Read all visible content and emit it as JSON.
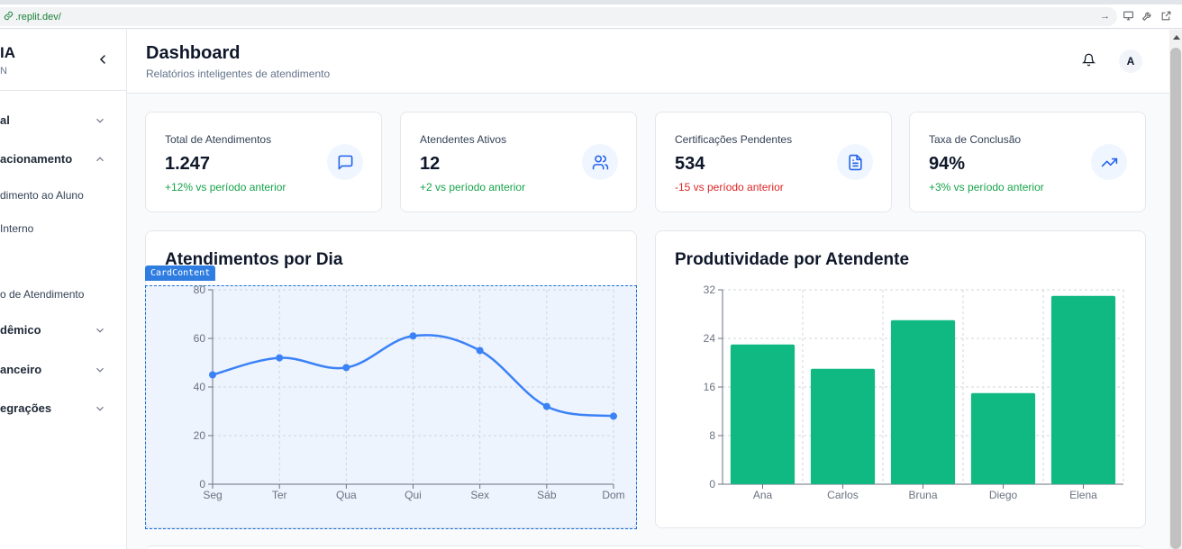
{
  "browser": {
    "url": ".replit.dev/",
    "icons": [
      "link-icon",
      "arrow-right-icon",
      "monitor-icon",
      "wrench-icon",
      "external-link-icon"
    ]
  },
  "sidebar": {
    "brand_title": "IA",
    "brand_subtitle": "N",
    "items": [
      {
        "label": "al",
        "kind": "group",
        "expanded": false
      },
      {
        "label": "acionamento",
        "kind": "group",
        "expanded": true
      },
      {
        "label": "dimento ao Aluno",
        "kind": "sub"
      },
      {
        "label": " Interno",
        "kind": "sub"
      },
      {
        "label": "o de Atendimento",
        "kind": "sub"
      },
      {
        "label": "dêmico",
        "kind": "group",
        "expanded": false
      },
      {
        "label": "anceiro",
        "kind": "group",
        "expanded": false
      },
      {
        "label": "egrações",
        "kind": "group",
        "expanded": false
      }
    ]
  },
  "header": {
    "title": "Dashboard",
    "subtitle": "Relatórios inteligentes de atendimento",
    "avatar_initial": "A"
  },
  "stats": [
    {
      "label": "Total de Atendimentos",
      "value": "1.247",
      "delta": "+12% vs período anterior",
      "trend": "up",
      "icon": "message-square-icon"
    },
    {
      "label": "Atendentes Ativos",
      "value": "12",
      "delta": "+2 vs período anterior",
      "trend": "up",
      "icon": "users-icon"
    },
    {
      "label": "Certificações Pendentes",
      "value": "534",
      "delta": "-15 vs período anterior",
      "trend": "down",
      "icon": "file-text-icon"
    },
    {
      "label": "Taxa de Conclusão",
      "value": "94%",
      "delta": "+3% vs período anterior",
      "trend": "up",
      "icon": "trending-up-icon"
    }
  ],
  "overlay_tag": "CardContent",
  "colors": {
    "line": "#3b82f6",
    "bar": "#10b981",
    "positive": "#16a34a",
    "negative": "#dc2626"
  },
  "chart_data": [
    {
      "type": "line",
      "title": "Atendimentos por Dia",
      "categories": [
        "Seg",
        "Ter",
        "Qua",
        "Qui",
        "Sex",
        "Sáb",
        "Dom"
      ],
      "series": [
        {
          "values": [
            45,
            52,
            48,
            61,
            55,
            32,
            28
          ]
        }
      ],
      "ylim": [
        0,
        80
      ],
      "yticks": [
        0,
        20,
        40,
        60,
        80
      ],
      "grid": true,
      "xlabel": "",
      "ylabel": ""
    },
    {
      "type": "bar",
      "title": "Produtividade por Atendente",
      "categories": [
        "Ana",
        "Carlos",
        "Bruna",
        "Diego",
        "Elena"
      ],
      "values": [
        23,
        19,
        27,
        15,
        31
      ],
      "ylim": [
        0,
        32
      ],
      "yticks": [
        0,
        8,
        16,
        24,
        32
      ],
      "grid": true,
      "xlabel": "",
      "ylabel": ""
    }
  ]
}
